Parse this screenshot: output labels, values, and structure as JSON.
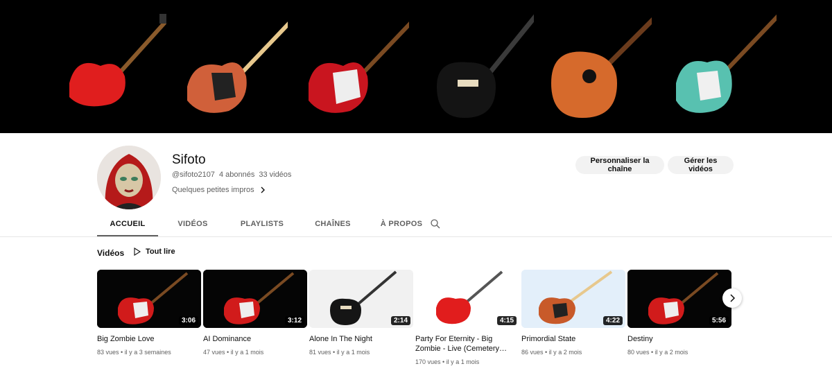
{
  "channel": {
    "name": "Sifoto",
    "handle": "@sifoto2107",
    "subscribers": "4 abonnés",
    "video_count": "33 vidéos",
    "description": "Quelques petites impros"
  },
  "buttons": {
    "customize": "Personnaliser la chaîne",
    "manage": "Gérer les vidéos"
  },
  "tabs": [
    {
      "label": "ACCUEIL",
      "active": true
    },
    {
      "label": "VIDÉOS",
      "active": false
    },
    {
      "label": "PLAYLISTS",
      "active": false
    },
    {
      "label": "CHAÎNES",
      "active": false
    },
    {
      "label": "À PROPOS",
      "active": false
    }
  ],
  "section": {
    "title": "Vidéos",
    "play_all": "Tout lire"
  },
  "videos": [
    {
      "title": "Big Zombie Love",
      "duration": "3:06",
      "views": "83 vues",
      "age": "il y a 3 semaines"
    },
    {
      "title": "AI Dominance",
      "duration": "3:12",
      "views": "47 vues",
      "age": "il y a 1 mois"
    },
    {
      "title": "Alone In The Night",
      "duration": "2:14",
      "views": "81 vues",
      "age": "il y a 1 mois"
    },
    {
      "title": "Party For Eternity - Big Zombie - Live (Cemetery…",
      "duration": "4:15",
      "views": "170 vues",
      "age": "il y a 1 mois"
    },
    {
      "title": "Primordial State",
      "duration": "4:22",
      "views": "86 vues",
      "age": "il y a 2 mois"
    },
    {
      "title": "Destiny",
      "duration": "5:56",
      "views": "80 vues",
      "age": "il y a 2 mois"
    }
  ],
  "colors": {
    "banner_bg": "#000000",
    "pill_bg": "#f2f2f2",
    "text_secondary": "#606060"
  },
  "icons": {
    "search": "search-icon",
    "play": "play-icon",
    "chevron": "chevron-right-icon"
  }
}
